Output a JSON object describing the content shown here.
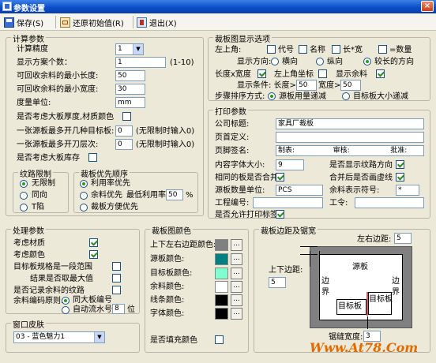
{
  "window": {
    "title": "参数设置",
    "close": "×"
  },
  "toolbar": {
    "save": "保存(S)",
    "restore": "还原初始值(R)",
    "exit": "退出(X)"
  },
  "calc": {
    "title": "计算参数",
    "precision_label": "计算精度",
    "precision_value": "1",
    "display_count_label": "显示方案个数：",
    "display_count_value": "1",
    "display_count_range": "(1-10)",
    "min_len_label": "可回收余料的最小长度:",
    "min_len_value": "50",
    "min_wid_label": "可回收余料的最小宽度:",
    "min_wid_value": "30",
    "unit_label": "度量单位:",
    "unit_value": "mm",
    "consider_thickness_label": "是否考虑大板厚度,材质颜色",
    "max_boards_label": "一张源板最多开几种目标板:",
    "max_boards_value": "0",
    "max_boards_hint": "(无限制时输入0)",
    "max_layers_label": "一张源板最多开刀层次:",
    "max_layers_value": "0",
    "max_layers_hint": "(无限制时输入0)",
    "consider_stock_label": "是否考虑大板库存",
    "grain": {
      "title": "纹路限制",
      "opt1": "无限制",
      "opt2": "同向",
      "opt3": "T陷"
    },
    "priority": {
      "title": "裁板优先顺序",
      "opt1": "利用率优先",
      "opt2": "余料优先",
      "min_rate_label": "最低利用率:",
      "min_rate_value": "50",
      "pct": "%",
      "opt3": "裁板方便优先"
    }
  },
  "cut": {
    "title": "裁板图显示选项",
    "top_left_label": "左上角:",
    "code": "代号",
    "name": "名称",
    "lw": "长*宽",
    "eq_qty": "=数量",
    "dir_label": "显示方向:",
    "dir_h": "横向",
    "dir_v": "纵向",
    "dir_long": "较长的方向",
    "lw_label": "长度x宽度",
    "coord_label": "左上角坐标",
    "remain_label": "显示余料",
    "cond_label": "显示条件: 长度>=",
    "cond_len": "50",
    "cond_wid_label": "宽度>=",
    "cond_wid": "50",
    "order_label": "步骤排序方式:",
    "order_opt1": "源板用量递减",
    "order_opt2": "目标板大小递减"
  },
  "print": {
    "title": "打印参数",
    "company_label": "公司标题:",
    "company_value": "家具厂裁板",
    "header_label": "页首定义:",
    "header_value": "",
    "footer_label": "页脚签名:",
    "footer_value": "制表:                 审核:                  批准:",
    "font_label": "内容字体大小:",
    "font_value": "9",
    "show_grain_label": "是否显示纹路方向",
    "merge_label": "相同的板是否合并",
    "merge_dash_label": "合并后是否画虚线",
    "src_unit_label": "源板数量单位:",
    "src_unit_value": "PCS",
    "remain_sym_label": "余料表示符号:",
    "remain_sym_value": "*",
    "project_label": "工程编号:",
    "project_value": "",
    "work_label": "工令:",
    "work_value": "",
    "allow_label_label": "是否允许打印标签"
  },
  "process": {
    "title": "处理参数",
    "material_label": "考虑材质",
    "color_label": "考虑颜色",
    "range_label": "目标板规格是一段范围",
    "maxval_label": "结果是否取最大值",
    "record_label": "是否记录余料的纹路",
    "remain_code_label": "余料编码原则:",
    "same_big_label": "同大板编号",
    "auto_label": "自动流水号",
    "auto_value": "8",
    "digit_label": "位"
  },
  "colors": {
    "title": "裁板图颜色",
    "edge_label": "上下左右边距颜色:",
    "src_label": "源板颜色:",
    "tgt_label": "目标板颜色:",
    "remain_label": "余料颜色:",
    "line_label": "线条颜色:",
    "font_label": "字体颜色:",
    "fill_label": "是否填充颜色",
    "edge": "#808080",
    "src": "#008080",
    "tgt": "#80ffd0",
    "remain": "#ffffff",
    "line": "#000000",
    "font": "#000000",
    "btn": "..."
  },
  "margin": {
    "title": "裁板边距及锯宽",
    "left_label": "左右边距:",
    "left_value": "5",
    "top_label": "上下边距:",
    "top_value": "5",
    "saw_label": "锯缝宽度:",
    "saw_value": "3",
    "src_text": "源板",
    "edge_left": "边界",
    "edge_right": "边界",
    "tgt1": "目标板",
    "tgt2": "目标板"
  },
  "skin": {
    "title": "窗口皮肤",
    "value": "03 - 蓝色魅力1"
  },
  "watermark": "Www.At78.Com"
}
